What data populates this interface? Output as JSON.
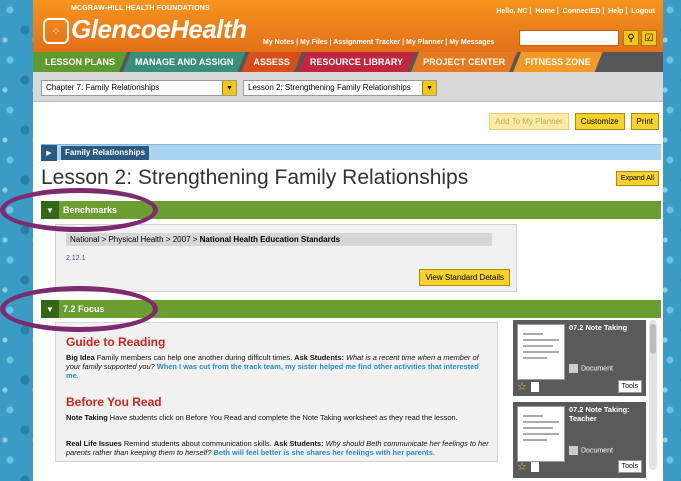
{
  "header": {
    "brand_small": "MCGRAW-HILL HEALTH FOUNDATIONS",
    "brand_main": "GlencoeHealth",
    "top_links": [
      "Hello, NC",
      "Home",
      "ConnectED",
      "Help",
      "Logout"
    ],
    "nav_links": [
      "My Notes",
      "My Files",
      "Assignment Tracker",
      "My Planner",
      "My Messages"
    ],
    "search_placeholder": ""
  },
  "tabs": [
    {
      "label": "LESSON PLANS",
      "color": "#5e9a2e"
    },
    {
      "label": "MANAGE AND ASSIGN",
      "color": "#3a8f7a"
    },
    {
      "label": "ASSESS",
      "color": "#d94d1a"
    },
    {
      "label": "RESOURCE LIBRARY",
      "color": "#c0263e"
    },
    {
      "label": "PROJECT CENTER",
      "color": "#e57a22"
    },
    {
      "label": "FITNESS ZONE",
      "color": "#f29a26"
    }
  ],
  "selectors": {
    "chapter": "Chapter 7: Family Relationships",
    "lesson": "Lesson 2: Strengthening Family Relationships"
  },
  "actions": {
    "add_planner": "Add To My Planner",
    "customize": "Customize",
    "print": "Print"
  },
  "family_bar": "Family Relationships",
  "lesson_title": "Lesson 2: Strengthening Family Relationships",
  "expand_all": "Expand All",
  "benchmarks": {
    "label": "Benchmarks",
    "path_prefix": "National > Physical Health > 2007 > ",
    "path_bold": "National Health Education Standards",
    "code": "2.12.1",
    "view_button": "View Standard Details"
  },
  "focus": {
    "label": "7.2 Focus",
    "guide_heading": "Guide to Reading",
    "guide_big_idea_label": "Big Idea",
    "guide_big_idea_text": " Family members can help one another during difficult times. ",
    "guide_ask_label": "Ask Students:",
    "guide_question": " What is a recent time when a member of your family supported you?",
    "guide_answer": " When I was cut from the track team, my sister helped me find other activities that interested me.",
    "before_heading": "Before You Read",
    "note_label": "Note Taking",
    "note_text": " Have students click on Before You Read and complete the Note Taking worksheet as they read the lesson.",
    "real_label": "Real Life Issues",
    "real_text": " Remind students about communication skills. ",
    "real_ask_label": "Ask Students:",
    "real_question": " Why should Beth communicate her feelings to her parents rather than keeping them to herself?",
    "real_answer": " Beth will feel better is she shares her feelings with her parents."
  },
  "resources": [
    {
      "title": "07.2 Note Taking",
      "type": "Document",
      "tools": "Tools"
    },
    {
      "title": "07.2 Note Taking: Teacher",
      "type": "Document",
      "tools": "Tools"
    }
  ]
}
